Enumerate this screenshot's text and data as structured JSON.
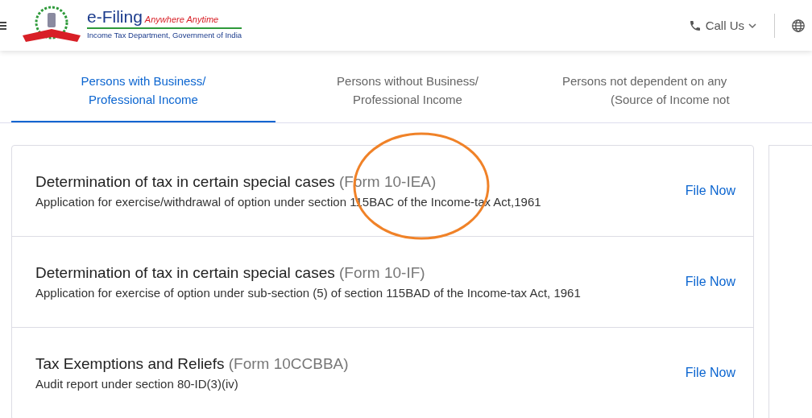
{
  "header": {
    "brand": "e-Filing",
    "tagline": "Anywhere Anytime",
    "subtitle": "Income Tax Department, Government of India",
    "call_us": "Call Us"
  },
  "tabs": [
    {
      "lines": [
        "Persons with Business/",
        "Professional Income"
      ],
      "selected": true
    },
    {
      "lines": [
        "Persons without Business/",
        "Professional Income"
      ],
      "selected": false
    },
    {
      "lines": [
        "Persons not dependent on any",
        "(Source of Income not"
      ],
      "selected": false
    }
  ],
  "forms": [
    {
      "title": "Determination of tax in certain special cases",
      "form": "(Form 10-IEA)",
      "description": "Application for exercise/withdrawal of option under section 115BAC of the Income-tax Act,1961",
      "action": "File Now",
      "highlighted": true
    },
    {
      "title": "Determination of tax in certain special cases",
      "form": "(Form 10-IF)",
      "description": "Application for exercise of option under sub-section (5) of section 115BAD of the Income-tax Act, 1961",
      "action": "File Now",
      "highlighted": false
    },
    {
      "title": "Tax Exemptions and Reliefs",
      "form": "(Form 10CCBBA)",
      "description": "Audit report under section 80-ID(3)(iv)",
      "action": "File Now",
      "highlighted": false
    }
  ]
}
